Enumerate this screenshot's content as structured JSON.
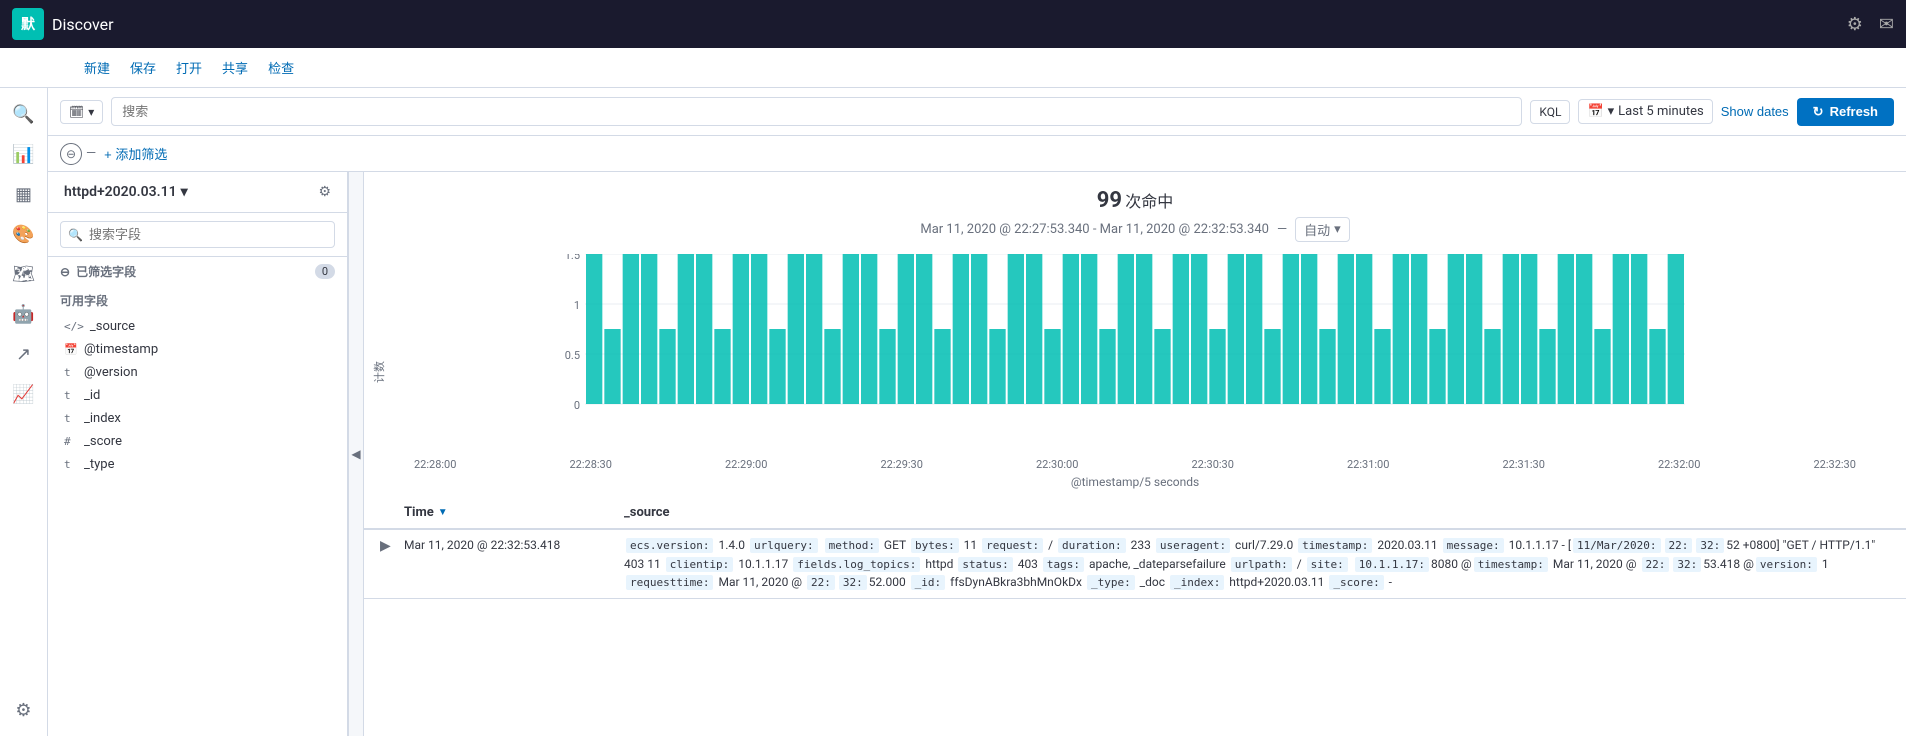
{
  "topbar": {
    "logo_text": "默",
    "app_title": "Discover",
    "icon_user": "⚙",
    "icon_mail": "✉"
  },
  "toolbar": {
    "new_label": "新建",
    "save_label": "保存",
    "open_label": "打开",
    "share_label": "共享",
    "inspect_label": "检查"
  },
  "searchbar": {
    "index_label": "🗓",
    "search_placeholder": "搜索",
    "kql_label": "KQL",
    "time_icon": "📅",
    "time_value": "Last 5 minutes",
    "show_dates_label": "Show dates",
    "refresh_label": "Refresh"
  },
  "filterbar": {
    "add_filter_label": "+ 添加筛选"
  },
  "sidebar": {
    "index_pattern": "httpd+2020.03.11",
    "search_placeholder": "搜索字段",
    "selected_fields_label": "已筛选字段",
    "selected_count": "0",
    "available_fields_label": "可用字段",
    "source_field": "_source",
    "fields": [
      {
        "type": "📅",
        "name": "@timestamp"
      },
      {
        "type": "t",
        "name": "@version"
      },
      {
        "type": "t",
        "name": "_id"
      },
      {
        "type": "t",
        "name": "_index"
      },
      {
        "type": "#",
        "name": "_score"
      },
      {
        "type": "t",
        "name": "_type"
      }
    ]
  },
  "chart": {
    "hit_count": "99",
    "hit_label": "次命中",
    "time_range": "Mar 11, 2020 @ 22:27:53.340 - Mar 11, 2020 @ 22:32:53.340",
    "auto_label": "自动",
    "y_label": "计数",
    "x_label": "@timestamp/5 seconds",
    "x_ticks": [
      "22:28:00",
      "22:28:30",
      "22:29:00",
      "22:29:30",
      "22:30:00",
      "22:30:30",
      "22:31:00",
      "22:31:30",
      "22:32:00",
      "22:32:30"
    ],
    "bars": [
      2,
      1,
      2,
      2,
      1,
      2,
      2,
      1,
      2,
      2,
      1,
      2,
      2,
      1,
      2,
      2,
      1,
      2,
      2,
      1,
      2,
      2,
      1,
      2,
      2,
      1,
      2,
      2,
      1,
      2,
      2,
      1,
      2,
      2,
      1,
      2,
      2,
      1,
      2,
      2,
      1,
      2,
      2,
      1,
      2,
      2,
      1,
      2,
      2,
      1,
      2,
      2,
      1,
      2,
      2,
      1,
      2,
      2,
      1,
      2
    ]
  },
  "table": {
    "col_time": "Time",
    "col_source": "_source",
    "rows": [
      {
        "timestamp": "Mar 11, 2020 @ 22:32:53.418",
        "source": "ecs.version: 1.4.0  urlquery:  method: GET  bytes: 11  request: /  duration: 233  useragent: curl/7.29.0  timestamp: 2020.03.11  message: 10.1.1.17 - [11/Mar/2020:22:32:52 +0800] \"GET / HTTP/1.1\" 403 11  clientip: 10.1.1.17  fields.log_topics: httpd  status: 403  tags: apache, _dateparsefailure  urlpath: /  site: 10.1.1.17:8080  @timestamp: Mar 11, 2020 @ 22:32:53.418  @version: 1  requesttime: Mar 11, 2020 @ 22:32:52.000  _id: ffsDynABkra3bhMnOkDx  _type: _doc  _index: httpd+2020.03.11  _score: -"
      }
    ]
  },
  "leftnav": {
    "icons": [
      "🔍",
      "📊",
      "📋",
      "👤",
      "🔧",
      "🔗",
      "🔄",
      "⚙"
    ]
  }
}
